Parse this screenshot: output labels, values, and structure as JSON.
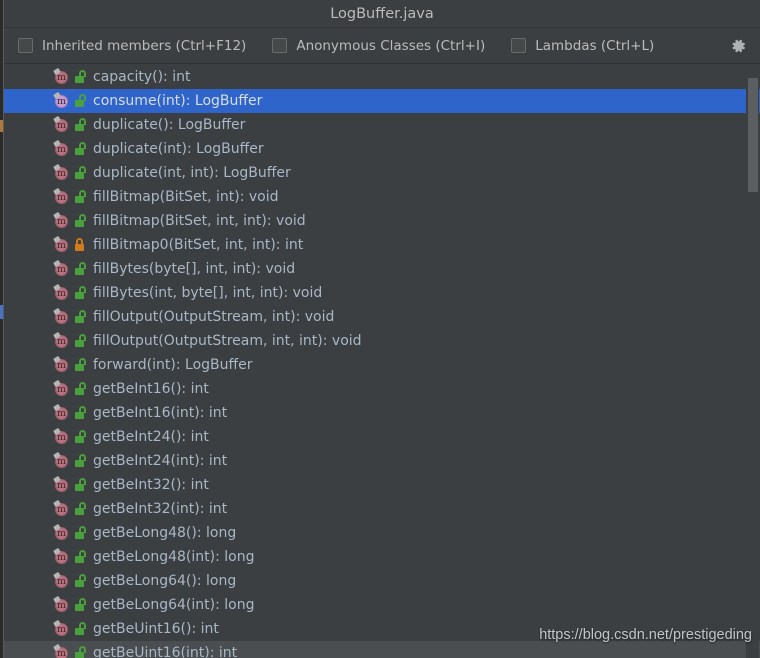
{
  "window": {
    "title": "LogBuffer.java"
  },
  "toolbar": {
    "filters": [
      {
        "label": "Inherited members (Ctrl+F12)",
        "checked": false
      },
      {
        "label": "Anonymous Classes (Ctrl+I)",
        "checked": false
      },
      {
        "label": "Lambdas (Ctrl+L)",
        "checked": false
      }
    ],
    "settings_icon": "gear-icon"
  },
  "colors": {
    "selection": "#2f65ca",
    "background": "#3c3f41",
    "text": "#a9b7c6",
    "public_lock": "#4aa03c",
    "private_lock": "#cf7b1c",
    "method_icon": "#b9707f"
  },
  "structure_list": {
    "selected_index": 1,
    "hover_index": 24,
    "items": [
      {
        "label": "capacity(): int",
        "icon": "method-icon",
        "visibility": "public"
      },
      {
        "label": "consume(int): LogBuffer",
        "icon": "method-icon",
        "visibility": "public"
      },
      {
        "label": "duplicate(): LogBuffer",
        "icon": "method-icon",
        "visibility": "public"
      },
      {
        "label": "duplicate(int): LogBuffer",
        "icon": "method-icon",
        "visibility": "public"
      },
      {
        "label": "duplicate(int, int): LogBuffer",
        "icon": "method-icon",
        "visibility": "public"
      },
      {
        "label": "fillBitmap(BitSet, int): void",
        "icon": "method-icon",
        "visibility": "public"
      },
      {
        "label": "fillBitmap(BitSet, int, int): void",
        "icon": "method-icon",
        "visibility": "public"
      },
      {
        "label": "fillBitmap0(BitSet, int, int): int",
        "icon": "method-icon",
        "visibility": "private"
      },
      {
        "label": "fillBytes(byte[], int, int): void",
        "icon": "method-icon",
        "visibility": "public"
      },
      {
        "label": "fillBytes(int, byte[], int, int): void",
        "icon": "method-icon",
        "visibility": "public"
      },
      {
        "label": "fillOutput(OutputStream, int): void",
        "icon": "method-icon",
        "visibility": "public"
      },
      {
        "label": "fillOutput(OutputStream, int, int): void",
        "icon": "method-icon",
        "visibility": "public"
      },
      {
        "label": "forward(int): LogBuffer",
        "icon": "method-icon",
        "visibility": "public"
      },
      {
        "label": "getBeInt16(): int",
        "icon": "method-icon",
        "visibility": "public"
      },
      {
        "label": "getBeInt16(int): int",
        "icon": "method-icon",
        "visibility": "public"
      },
      {
        "label": "getBeInt24(): int",
        "icon": "method-icon",
        "visibility": "public"
      },
      {
        "label": "getBeInt24(int): int",
        "icon": "method-icon",
        "visibility": "public"
      },
      {
        "label": "getBeInt32(): int",
        "icon": "method-icon",
        "visibility": "public"
      },
      {
        "label": "getBeInt32(int): int",
        "icon": "method-icon",
        "visibility": "public"
      },
      {
        "label": "getBeLong48(): long",
        "icon": "method-icon",
        "visibility": "public"
      },
      {
        "label": "getBeLong48(int): long",
        "icon": "method-icon",
        "visibility": "public"
      },
      {
        "label": "getBeLong64(): long",
        "icon": "method-icon",
        "visibility": "public"
      },
      {
        "label": "getBeLong64(int): long",
        "icon": "method-icon",
        "visibility": "public"
      },
      {
        "label": "getBeUint16(): int",
        "icon": "method-icon",
        "visibility": "public"
      },
      {
        "label": "getBeUint16(int): int",
        "icon": "method-icon",
        "visibility": "public"
      }
    ]
  },
  "watermark": {
    "text": "https://blog.csdn.net/prestigeding"
  }
}
